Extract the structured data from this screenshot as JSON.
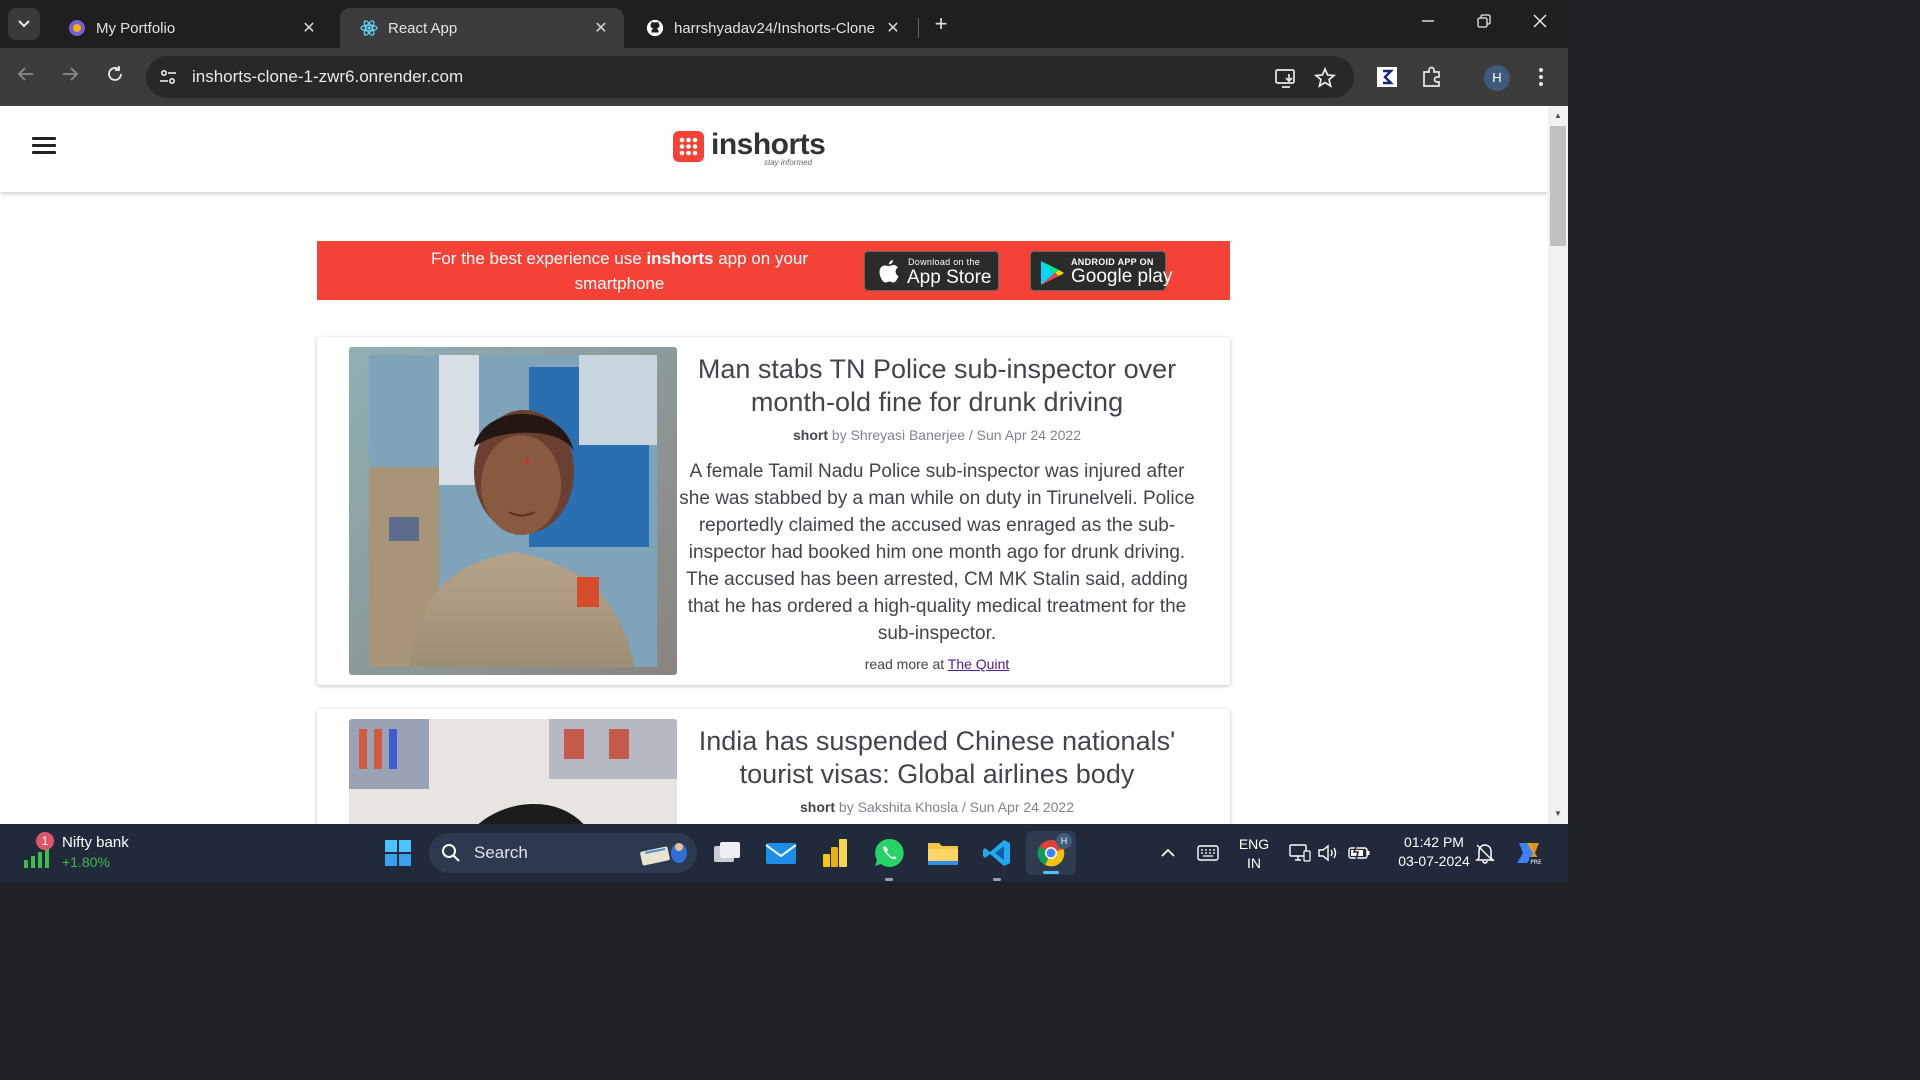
{
  "browser": {
    "tabs": [
      {
        "title": "My Portfolio",
        "active": false
      },
      {
        "title": "React App",
        "active": true
      },
      {
        "title": "harrshyadav24/Inshorts-Clone",
        "active": false
      }
    ],
    "url": "inshorts-clone-1-zwr6.onrender.com",
    "profile_initial": "H"
  },
  "site": {
    "logo_text": "inshorts",
    "logo_tagline": "stay informed",
    "promo": {
      "text_before": "For the best experience use ",
      "brand": "inshorts",
      "text_after": " app on your smartphone",
      "appstore_small": "Download on the",
      "appstore_big": "App Store",
      "googleplay_small": "ANDROID APP ON",
      "googleplay_big": "Google play"
    },
    "articles": [
      {
        "title": "Man stabs TN Police sub-inspector over month-old fine for drunk driving",
        "short_label": "short",
        "by_label": " by ",
        "author": "Shreyasi Banerjee",
        "date_sep": " / ",
        "date": "Sun Apr 24 2022",
        "description": "A female Tamil Nadu Police sub-inspector was injured after she was stabbed by a man while on duty in Tirunelveli. Police reportedly claimed the accused was enraged as the sub-inspector had booked him one month ago for drunk driving. The accused has been arrested, CM MK Stalin said, adding that he has ordered a high-quality medical treatment for the sub-inspector.",
        "read_more_label": "read more at ",
        "source": "The Quint"
      },
      {
        "title": "India has suspended Chinese nationals' tourist visas: Global airlines body",
        "short_label": "short",
        "by_label": " by ",
        "author": "Sakshita Khosla",
        "date_sep": " / ",
        "date": "Sun Apr 24 2022"
      }
    ]
  },
  "taskbar": {
    "widget_title": "Nifty bank",
    "widget_value": "+1.80%",
    "widget_badge": "1",
    "search_label": "Search",
    "lang_top": "ENG",
    "lang_bottom": "IN",
    "time": "01:42 PM",
    "date": "03-07-2024"
  },
  "colors": {
    "brand_red": "#f44336",
    "tab_bg": "#1f1f1f",
    "toolbar_bg": "#3c3c3c",
    "taskbar_bg": "#202a3a",
    "widget_green": "#3fb950"
  }
}
